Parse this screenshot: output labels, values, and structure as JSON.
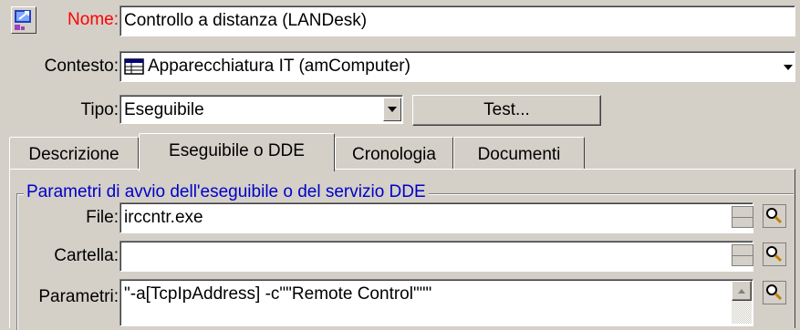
{
  "header": {
    "icon": "remote-control-icon",
    "name_label": "Nome:",
    "name_value": "Controllo a distanza (LANDesk)"
  },
  "context": {
    "label": "Contesto:",
    "icon": "table-icon",
    "value": "Apparecchiatura IT (amComputer)"
  },
  "type": {
    "label": "Tipo:",
    "value": "Eseguibile",
    "test_button": "Test..."
  },
  "tabs": [
    {
      "label": "Descrizione"
    },
    {
      "label": "Eseguibile o DDE",
      "active": true
    },
    {
      "label": "Cronologia"
    },
    {
      "label": "Documenti"
    }
  ],
  "group": {
    "title": "Parametri di avvio dell'eseguibile o del servizio DDE",
    "file_label": "File:",
    "file_value": "irccntr.exe",
    "folder_label": "Cartella:",
    "folder_value": "",
    "params_label": "Parametri:",
    "params_value": "\"-a[TcpIpAddress] -c\"\"Remote Control\"\"\""
  }
}
